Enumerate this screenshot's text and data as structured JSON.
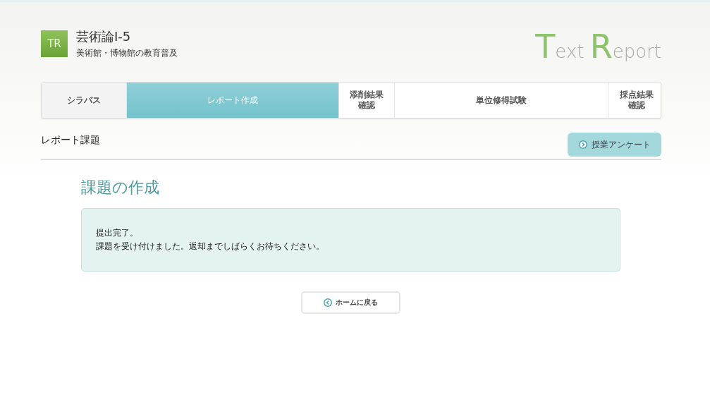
{
  "header": {
    "badge": "TR",
    "title": "芸術論I-5",
    "subtitle": "美術館・博物館の教育普及",
    "logo": [
      {
        "text": "T",
        "kind": "initial"
      },
      {
        "text": "ext ",
        "kind": "rest"
      },
      {
        "text": "R",
        "kind": "initial"
      },
      {
        "text": "eport",
        "kind": "rest"
      }
    ]
  },
  "steps": [
    {
      "label": "シラバス",
      "selected": false,
      "completed": true
    },
    {
      "label": "レポート作成",
      "selected": true,
      "completed": false
    },
    {
      "label": "添削結果確認",
      "selected": false,
      "completed": false
    },
    {
      "label": "単位修得試験",
      "selected": false,
      "completed": false
    },
    {
      "label": "採点結果確認",
      "selected": false,
      "completed": false
    }
  ],
  "section": {
    "title": "レポート課題",
    "survey_button": "授業アンケート"
  },
  "heading": "課題の作成",
  "message": [
    "提出完了。",
    "課題を受け付けました。返却までしばらくお待ちください。"
  ],
  "home_button": "ホームに戻る"
}
